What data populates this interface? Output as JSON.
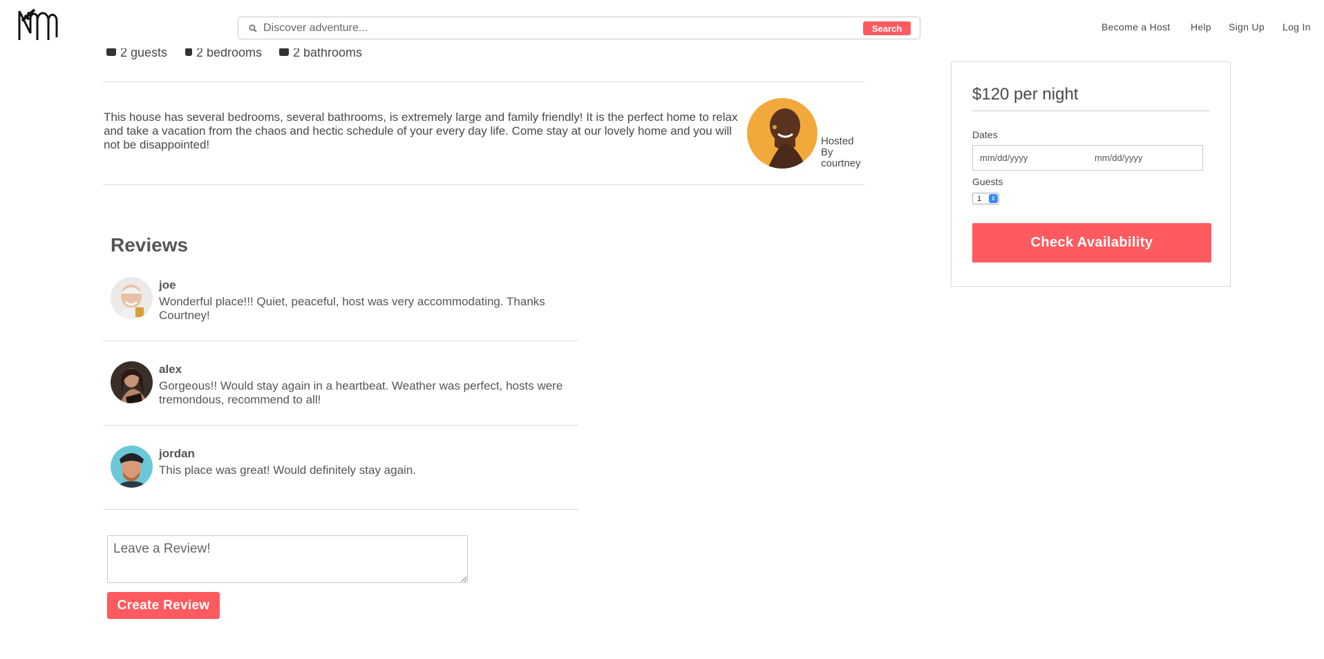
{
  "header": {
    "search": {
      "placeholder": "Discover adventure...",
      "button_label": "Search"
    },
    "nav": {
      "become_host": "Become a Host",
      "help": "Help",
      "sign_up": "Sign Up",
      "log_in": "Log In"
    }
  },
  "listing": {
    "stats": {
      "guests": "2 guests",
      "bedrooms": "2 bedrooms",
      "bathrooms": "2 bathrooms"
    },
    "description": "This house has several bedrooms, several bathrooms, is extremely large and family friendly! It is the perfect home to relax and take a vacation from the chaos and hectic schedule of your every day life. Come stay at our lovely home and you will not be disappointed!",
    "host": {
      "line1": "Hosted",
      "line2": "By",
      "name": "courtney"
    }
  },
  "reviews": {
    "title": "Reviews",
    "items": [
      {
        "author": "joe",
        "body": "Wonderful place!!! Quiet, peaceful, host was very accommodating. Thanks Courtney!"
      },
      {
        "author": "alex",
        "body": "Gorgeous!! Would stay again in a heartbeat. Weather was perfect, hosts were tremondous, recommend to all!"
      },
      {
        "author": "jordan",
        "body": "This place was great! Would definitely stay again."
      }
    ],
    "form": {
      "placeholder": "Leave a Review!",
      "button_label": "Create Review"
    }
  },
  "booking": {
    "price": "$120 per night",
    "dates_label": "Dates",
    "checkin_placeholder": "mm/dd/yyyy",
    "checkout_placeholder": "mm/dd/yyyy",
    "guests_label": "Guests",
    "guests_value": "1",
    "button_label": "Check Availability"
  },
  "colors": {
    "accent": "#ff5a5f",
    "text": "#484848",
    "divider": "#dcdcdc"
  }
}
